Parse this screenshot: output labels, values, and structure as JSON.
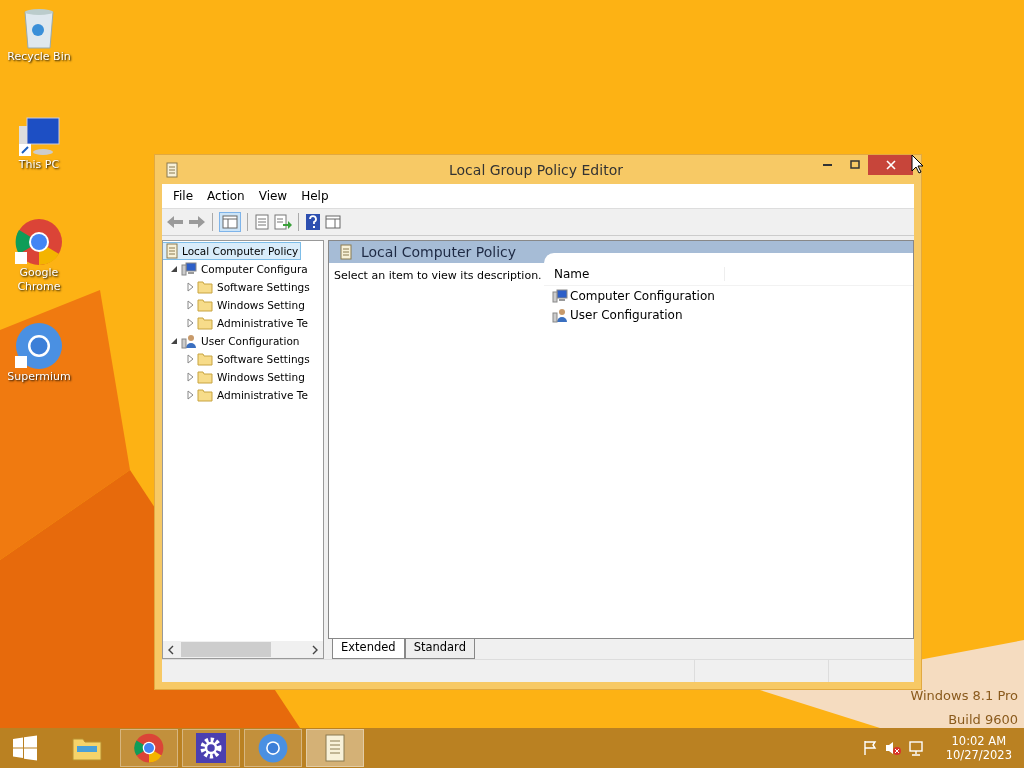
{
  "desktop_icons": [
    {
      "label": "Recycle Bin",
      "kind": "recycle"
    },
    {
      "label": "This PC",
      "kind": "pc"
    },
    {
      "label": "Google Chrome",
      "kind": "chrome"
    },
    {
      "label": "Supermium",
      "kind": "supermium"
    }
  ],
  "window": {
    "title": "Local Group Policy Editor",
    "menu": [
      "File",
      "Action",
      "View",
      "Help"
    ],
    "tree": [
      {
        "label": "Local Computer Policy",
        "kind": "policy",
        "selected": true,
        "children": [
          {
            "label": "Computer Configura",
            "kind": "computer",
            "selected": false,
            "expanded": true,
            "children": [
              {
                "label": "Software Settings",
                "kind": "folder",
                "selected": false,
                "expanded": false
              },
              {
                "label": "Windows Setting",
                "kind": "folder",
                "selected": false,
                "expanded": false
              },
              {
                "label": "Administrative Te",
                "kind": "folder",
                "selected": false,
                "expanded": false
              }
            ]
          },
          {
            "label": "User Configuration",
            "kind": "user",
            "selected": false,
            "expanded": true,
            "children": [
              {
                "label": "Software Settings",
                "kind": "folder",
                "selected": false,
                "expanded": false
              },
              {
                "label": "Windows Setting",
                "kind": "folder",
                "selected": false,
                "expanded": false
              },
              {
                "label": "Administrative Te",
                "kind": "folder",
                "selected": false,
                "expanded": false
              }
            ]
          }
        ]
      }
    ],
    "details": {
      "title": "Local Computer Policy",
      "description": "Select an item to view its description.",
      "column": "Name",
      "items": [
        {
          "label": "Computer Configuration",
          "kind": "computer"
        },
        {
          "label": "User Configuration",
          "kind": "user"
        }
      ]
    },
    "tabs": [
      {
        "label": "Extended",
        "selected": true
      },
      {
        "label": "Standard",
        "selected": false
      }
    ]
  },
  "edition": [
    "Windows 8.1 Pro",
    "Build 9600"
  ],
  "taskbar": {
    "apps": [
      {
        "kind": "explorer",
        "selected": false
      },
      {
        "kind": "chrome",
        "selected": false
      },
      {
        "kind": "settings",
        "selected": false
      },
      {
        "kind": "supermium",
        "selected": false
      },
      {
        "kind": "policy",
        "selected": true
      }
    ],
    "clock": {
      "time": "10:02 AM",
      "date": "10/27/2023"
    }
  }
}
